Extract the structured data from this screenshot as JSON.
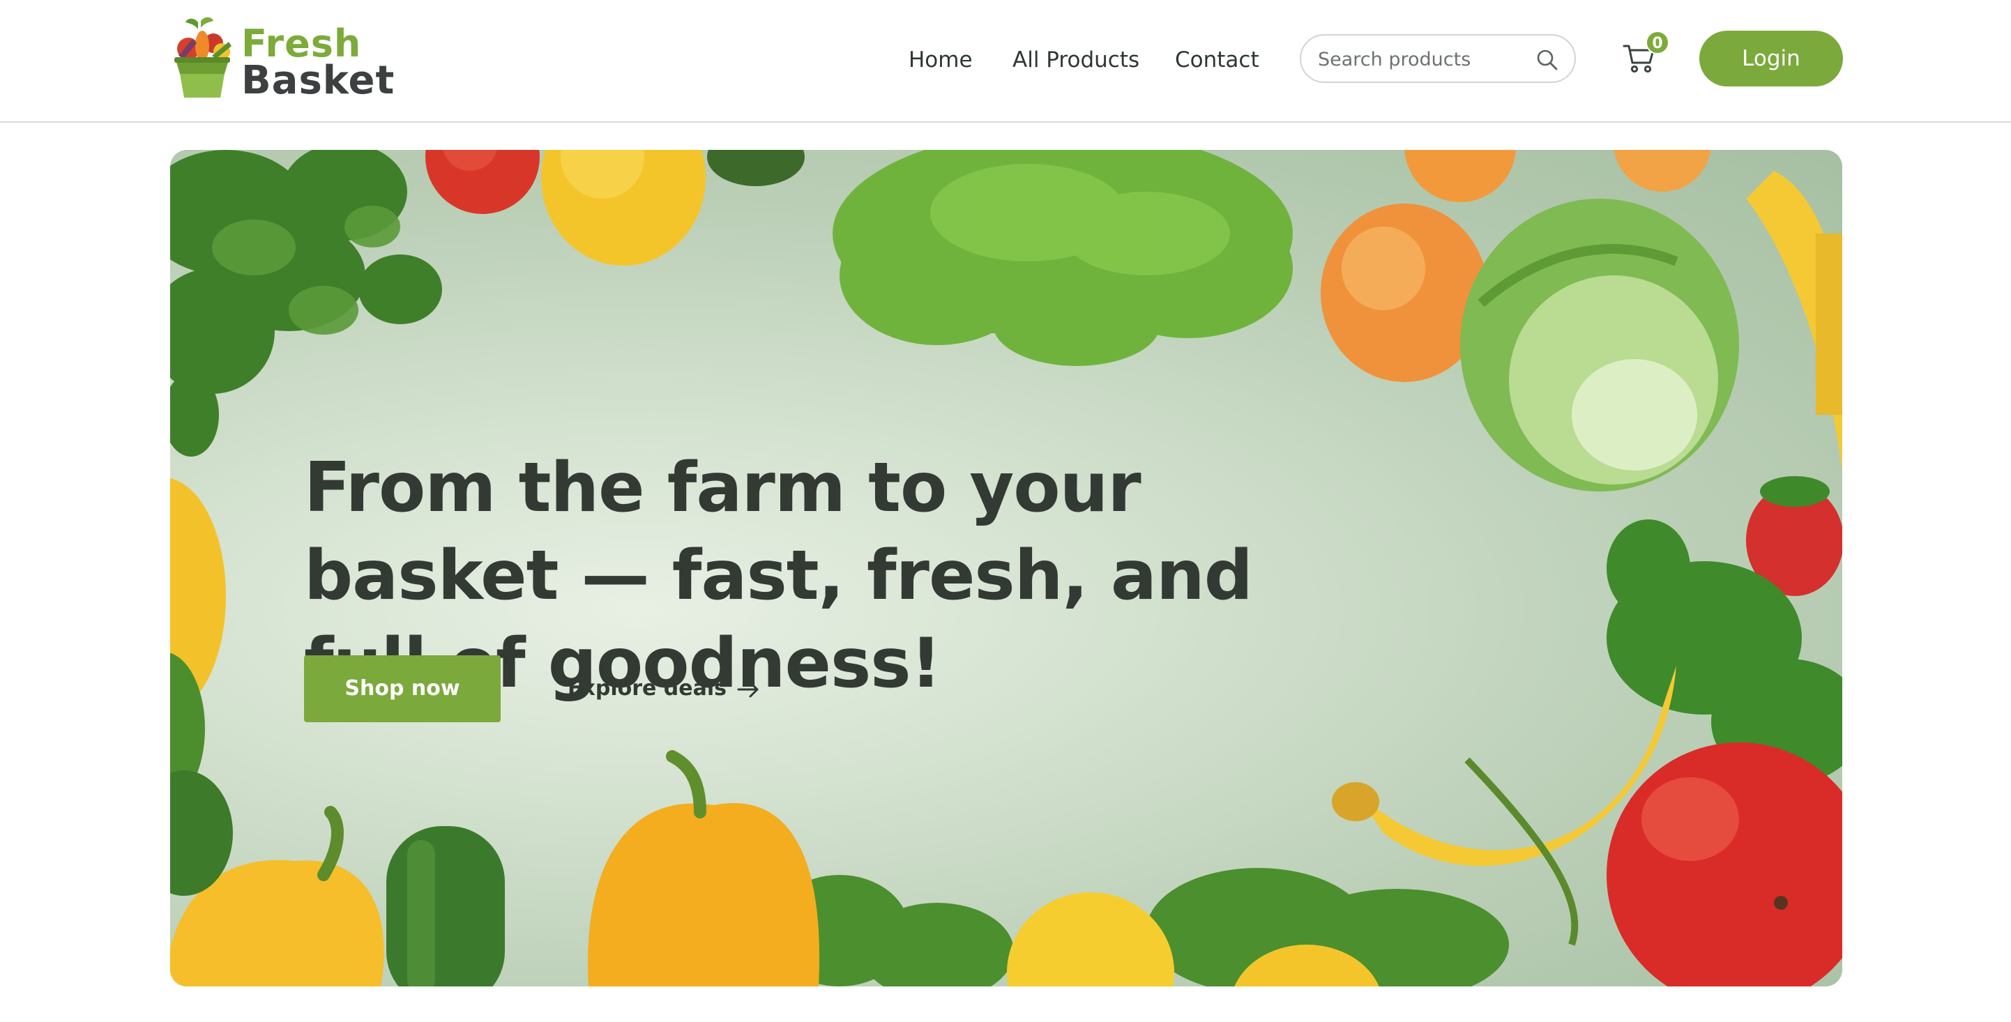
{
  "brand": {
    "name_top": "Fresh",
    "name_bottom": "Basket",
    "primary_color": "#7ba93b",
    "dark_color": "#333a34"
  },
  "nav": {
    "items": [
      {
        "label": "Home"
      },
      {
        "label": "All Products"
      },
      {
        "label": "Contact"
      }
    ]
  },
  "search": {
    "placeholder": "Search products",
    "value": "",
    "icon": "search-icon"
  },
  "cart": {
    "icon": "cart-icon",
    "count": "0"
  },
  "login": {
    "label": "Login"
  },
  "hero": {
    "title": "From the farm to your basket — fast, fresh, and full of goodness!",
    "primary_cta": "Shop now",
    "secondary_cta": "Explore deals",
    "secondary_icon": "arrow-right-icon"
  }
}
